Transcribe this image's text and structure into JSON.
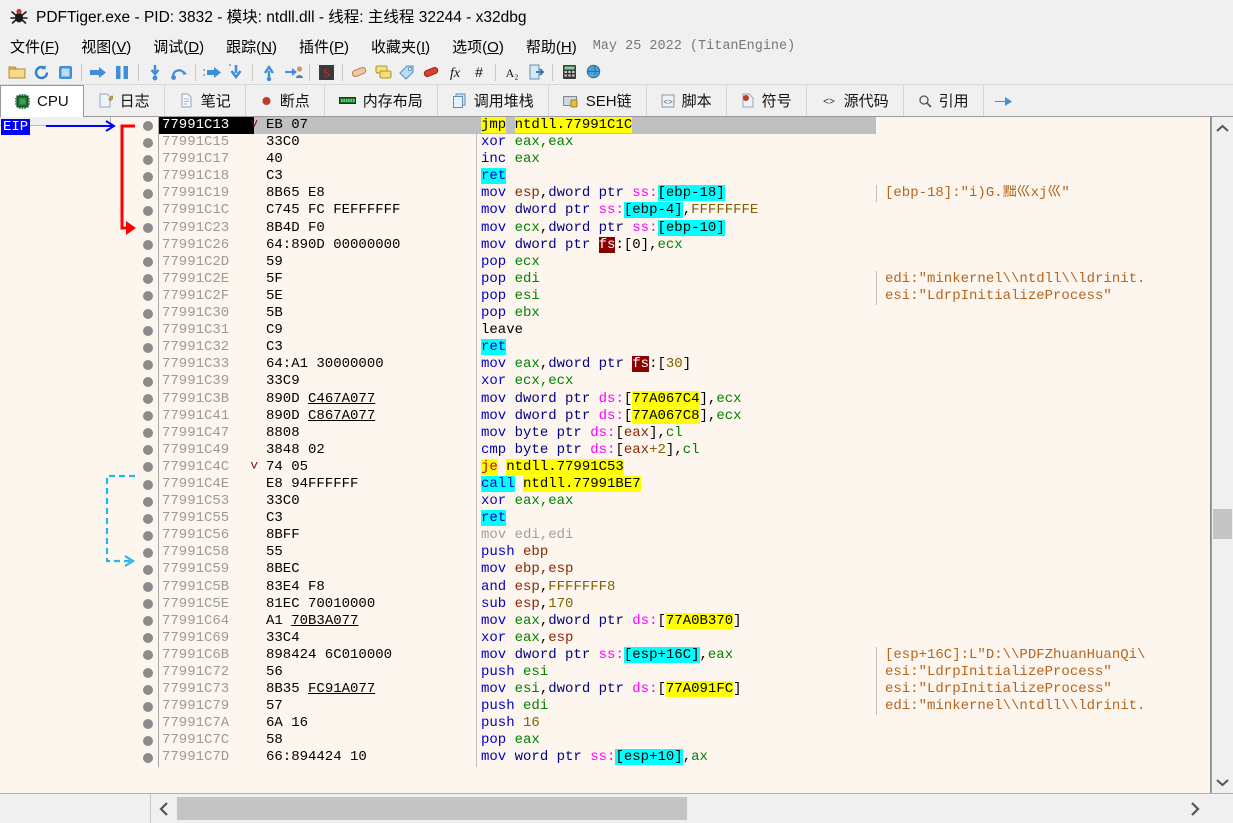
{
  "window": {
    "title": "PDFTiger.exe - PID: 3832 - 模块: ntdll.dll - 线程: 主线程 32244 - x32dbg",
    "app_icon": "bug-icon"
  },
  "menu": {
    "items": [
      {
        "label": "文件",
        "accel": "F"
      },
      {
        "label": "视图",
        "accel": "V"
      },
      {
        "label": "调试",
        "accel": "D"
      },
      {
        "label": "跟踪",
        "accel": "N"
      },
      {
        "label": "插件",
        "accel": "P"
      },
      {
        "label": "收藏夹",
        "accel": "I"
      },
      {
        "label": "选项",
        "accel": "O"
      },
      {
        "label": "帮助",
        "accel": "H"
      }
    ],
    "build_info": "May 25 2022 (TitanEngine)"
  },
  "toolbar": {
    "buttons": [
      {
        "name": "open-folder-icon"
      },
      {
        "name": "restart-icon"
      },
      {
        "name": "stop-icon"
      },
      {
        "sep": true
      },
      {
        "name": "run-icon"
      },
      {
        "name": "pause-icon"
      },
      {
        "sep": true
      },
      {
        "name": "step-into-icon"
      },
      {
        "name": "step-over-icon"
      },
      {
        "sep": true
      },
      {
        "name": "step-into-fast-icon"
      },
      {
        "name": "step-over-fast-icon"
      },
      {
        "sep": true
      },
      {
        "name": "execute-till-return-icon"
      },
      {
        "name": "run-to-user-code-icon"
      },
      {
        "sep": true
      },
      {
        "name": "scylla-icon"
      },
      {
        "sep": true
      },
      {
        "name": "patch-icon"
      },
      {
        "name": "comment-icon"
      },
      {
        "name": "label-icon"
      },
      {
        "name": "bookmark-icon"
      },
      {
        "name": "function-icon"
      },
      {
        "name": "hash-icon"
      },
      {
        "sep": true
      },
      {
        "name": "font-icon"
      },
      {
        "name": "export-icon"
      },
      {
        "sep": true
      },
      {
        "name": "calculator-icon"
      },
      {
        "name": "globe-icon"
      }
    ]
  },
  "tabs": [
    {
      "label": "CPU",
      "icon": "cpu-chip-icon",
      "active": true
    },
    {
      "label": "日志",
      "icon": "log-page-icon",
      "active": false
    },
    {
      "label": "笔记",
      "icon": "notes-page-icon",
      "active": false
    },
    {
      "label": "断点",
      "icon": "breakpoint-dot-icon",
      "active": false
    },
    {
      "label": "内存布局",
      "icon": "memory-map-icon",
      "active": false
    },
    {
      "label": "调用堆栈",
      "icon": "call-stack-icon",
      "active": false
    },
    {
      "label": "SEH链",
      "icon": "seh-icon",
      "active": false
    },
    {
      "label": "脚本",
      "icon": "script-icon",
      "active": false
    },
    {
      "label": "符号",
      "icon": "symbol-icon",
      "active": false
    },
    {
      "label": "源代码",
      "icon": "source-code-icon",
      "active": false
    },
    {
      "label": "引用",
      "icon": "references-magnifier-icon",
      "active": false
    }
  ],
  "tab_overflow_icon": "next-tabs-arrow-icon",
  "cpu": {
    "eip_label": "EIP",
    "rows": [
      {
        "addr": "77991C13",
        "hex": "EB 07",
        "selected": true
      },
      {
        "addr": "77991C15",
        "hex": "33C0"
      },
      {
        "addr": "77991C17",
        "hex": "40"
      },
      {
        "addr": "77991C18",
        "hex": "C3"
      },
      {
        "addr": "77991C19",
        "hex": "8B65 E8"
      },
      {
        "addr": "77991C1C",
        "hex": "C745 FC FEFFFFFF"
      },
      {
        "addr": "77991C23",
        "hex": "8B4D F0"
      },
      {
        "addr": "77991C26",
        "hex": "64:890D 00000000"
      },
      {
        "addr": "77991C2D",
        "hex": "59"
      },
      {
        "addr": "77991C2E",
        "hex": "5F"
      },
      {
        "addr": "77991C2F",
        "hex": "5E"
      },
      {
        "addr": "77991C30",
        "hex": "5B"
      },
      {
        "addr": "77991C31",
        "hex": "C9"
      },
      {
        "addr": "77991C32",
        "hex": "C3"
      },
      {
        "addr": "77991C33",
        "hex": "64:A1 30000000"
      },
      {
        "addr": "77991C39",
        "hex": "33C9"
      },
      {
        "addr": "77991C3B",
        "hex": "890D C467A077"
      },
      {
        "addr": "77991C41",
        "hex": "890D C867A077"
      },
      {
        "addr": "77991C47",
        "hex": "8808"
      },
      {
        "addr": "77991C49",
        "hex": "3848 02"
      },
      {
        "addr": "77991C4C",
        "hex": "74 05"
      },
      {
        "addr": "77991C4E",
        "hex": "E8 94FFFFFF"
      },
      {
        "addr": "77991C53",
        "hex": "33C0"
      },
      {
        "addr": "77991C55",
        "hex": "C3"
      },
      {
        "addr": "77991C56",
        "hex": "8BFF"
      },
      {
        "addr": "77991C58",
        "hex": "55"
      },
      {
        "addr": "77991C59",
        "hex": "8BEC"
      },
      {
        "addr": "77991C5B",
        "hex": "83E4 F8"
      },
      {
        "addr": "77991C5E",
        "hex": "81EC 70010000"
      },
      {
        "addr": "77991C64",
        "hex": "A1 70B3A077"
      },
      {
        "addr": "77991C69",
        "hex": "33C4"
      },
      {
        "addr": "77991C6B",
        "hex": "898424 6C010000"
      },
      {
        "addr": "77991C72",
        "hex": "56"
      },
      {
        "addr": "77991C73",
        "hex": "8B35 FC91A077"
      },
      {
        "addr": "77991C79",
        "hex": "57"
      },
      {
        "addr": "77991C7A",
        "hex": "6A 16"
      },
      {
        "addr": "77991C7C",
        "hex": "58"
      },
      {
        "addr": "77991C7D",
        "hex": "66:894424 10"
      }
    ],
    "instructions": [
      "jmp ntdll.77991C1C",
      "xor eax,eax",
      "inc eax",
      "ret",
      "mov esp,dword ptr ss:[ebp-18]",
      "mov dword ptr ss:[ebp-4],FFFFFFFE",
      "mov ecx,dword ptr ss:[ebp-10]",
      "mov dword ptr fs:[0],ecx",
      "pop ecx",
      "pop edi",
      "pop esi",
      "pop ebx",
      "leave",
      "ret",
      "mov eax,dword ptr fs:[30]",
      "xor ecx,ecx",
      "mov dword ptr ds:[77A067C4],ecx",
      "mov dword ptr ds:[77A067C8],ecx",
      "mov byte ptr ds:[eax],cl",
      "cmp byte ptr ds:[eax+2],cl",
      "je ntdll.77991C53",
      "call ntdll.77991BE7",
      "xor eax,eax",
      "ret",
      "mov edi,edi",
      "push ebp",
      "mov ebp,esp",
      "and esp,FFFFFFF8",
      "sub esp,170",
      "mov eax,dword ptr ds:[77A0B370]",
      "xor eax,esp",
      "mov dword ptr ss:[esp+16C],eax",
      "push esi",
      "mov esi,dword ptr ds:[77A091FC]",
      "push edi",
      "push 16",
      "pop eax",
      "mov word ptr ss:[esp+10],ax"
    ],
    "comments": {
      "4": "[ebp-18]:\"i)G.黜巛xj巛\"",
      "9": "edi:\"minkernel\\\\ntdll\\\\ldrinit.",
      "10": "esi:\"LdrpInitializeProcess\"",
      "31": "[esp+16C]:L\"D:\\\\PDFZhuanHuanQi\\",
      "32": "esi:\"LdrpInitializeProcess\"",
      "33": "esi:\"LdrpInitializeProcess\"",
      "34": "edi:\"minkernel\\\\ntdll\\\\ldrinit."
    }
  },
  "scrollbars": {
    "vertical_up_icon": "chevron-up-icon",
    "vertical_down_icon": "chevron-down-icon",
    "horizontal_left_icon": "chevron-left-icon",
    "horizontal_right_icon": "chevron-right-icon"
  },
  "colors": {
    "background": "#fdf6ee",
    "mnemonic": "#0000c0",
    "register": "#008000",
    "comment": "#b5651d",
    "highlight": "#ffff00",
    "selection": "#c0c0c0",
    "segment_fs": "#8b0000",
    "eip_badge": "#0000ff"
  }
}
